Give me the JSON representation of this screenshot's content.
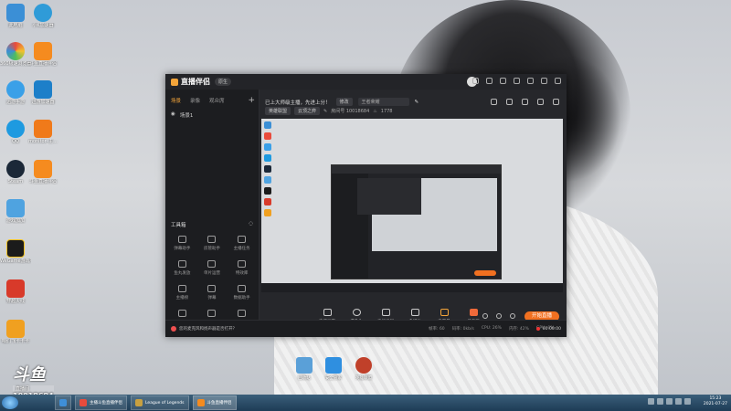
{
  "desktop": {
    "icons": [
      {
        "label": "此电脑",
        "color": "#3b8fd6"
      },
      {
        "label": "小K加速器",
        "color": "#2f9bd8"
      },
      {
        "label": "360极速浏览器",
        "color": "#e94b3c"
      },
      {
        "label": "斗鱼直播伴侣",
        "color": "#f58b1f"
      },
      {
        "label": "迅游手游",
        "color": "#3aa0e8"
      },
      {
        "label": "迅游加速器",
        "color": "#1d7fc9"
      },
      {
        "label": "QQ",
        "color": "#1e9ae0"
      },
      {
        "label": "monitor_主...",
        "color": "#f07a1a"
      },
      {
        "label": "Steam",
        "color": "#1b2838"
      },
      {
        "label": "斗鱼直播伴侣",
        "color": "#f58b1f"
      },
      {
        "label": "游戏加加",
        "color": "#4fa3e0"
      },
      {
        "label": "WeGame游戏平台",
        "color": "#1b1b1b"
      },
      {
        "label": "穿越火线",
        "color": "#d83a2a"
      },
      {
        "label": "咱们飞卡卡卡",
        "color": "#f0a020"
      }
    ],
    "bottom_icons": [
      {
        "label": "回收站",
        "color": "#5aa0d8"
      },
      {
        "label": "安全管家",
        "color": "#2f8fe0"
      },
      {
        "label": "英雄联盟",
        "color": "#c0402a"
      }
    ],
    "watermark": {
      "brand": "斗鱼",
      "tag": "直播间",
      "room": "10018684"
    }
  },
  "app": {
    "title": "直播伴侣",
    "version_badge": "原生",
    "sidebar": {
      "tabs": [
        "场景",
        "录像",
        "观众席"
      ],
      "scene_label": "场景1",
      "tools_title": "工具箱",
      "tools": [
        "弹幕助手",
        "房管助手",
        "主播任务",
        "鱼丸发放",
        "单片运营",
        "特效库",
        "主播榜",
        "弹幕",
        "数据助手",
        "礼物",
        "",
        ""
      ]
    },
    "main": {
      "notice": "已上大师级主播，先进上分！",
      "edit_label": "修改",
      "room_name": "王者荣耀",
      "category": "英雄联盟",
      "sub_category": "云顶之弈",
      "room_id_label": "房间号 10018684",
      "fans": "1778"
    },
    "controls": [
      "直播画面",
      "摄像头",
      "手机投屏",
      "多媒体",
      "麦克风",
      "扬声器"
    ],
    "go_live": "开始直播",
    "status": {
      "prompt": "您的麦克风和扬声器是否打开？",
      "stats": [
        "帧率: 60",
        "码率: 0kb/s",
        "CPU: 26%",
        "内存: 42%",
        "GPU: 0%"
      ],
      "time": "00:00:00"
    }
  },
  "taskbar": {
    "items": [
      {
        "label": "",
        "color": "#3f8fd8"
      },
      {
        "label": "主播斗鱼直播伴侣",
        "color": "#e94b3c"
      },
      {
        "label": "League of Legends",
        "color": "#c8a040"
      },
      {
        "label": "斗鱼直播伴侣",
        "color": "#f58b1f"
      }
    ],
    "time": "15:23",
    "date": "2021-07-27"
  }
}
